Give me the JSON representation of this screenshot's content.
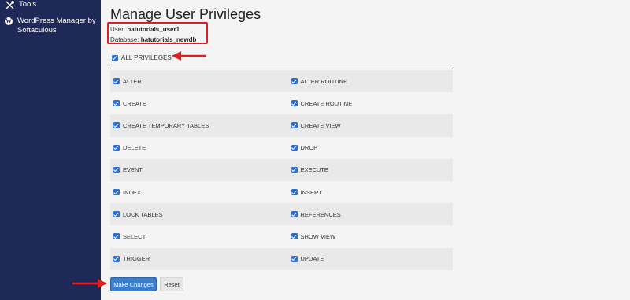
{
  "sidebar": {
    "items": [
      {
        "label": "Tools",
        "icon": "tools-icon"
      },
      {
        "label": "WordPress Manager by Softaculous",
        "icon": "wordpress-icon"
      }
    ]
  },
  "main": {
    "title": "Manage User Privileges",
    "user_label": "User:",
    "user_value": "hatutorials_user1",
    "database_label": "Database:",
    "database_value": "hatutorials_newdb",
    "all_privileges_label": "ALL PRIVILEGES",
    "privileges": [
      [
        "ALTER",
        "ALTER ROUTINE"
      ],
      [
        "CREATE",
        "CREATE ROUTINE"
      ],
      [
        "CREATE TEMPORARY TABLES",
        "CREATE VIEW"
      ],
      [
        "DELETE",
        "DROP"
      ],
      [
        "EVENT",
        "EXECUTE"
      ],
      [
        "INDEX",
        "INSERT"
      ],
      [
        "LOCK TABLES",
        "REFERENCES"
      ],
      [
        "SELECT",
        "SHOW VIEW"
      ],
      [
        "TRIGGER",
        "UPDATE"
      ]
    ],
    "make_changes_label": "Make Changes",
    "reset_label": "Reset"
  },
  "colors": {
    "sidebar_bg": "#1f2957",
    "checkbox": "#2e6fd6",
    "primary_button": "#3b7dc8",
    "annotation": "#e02020"
  }
}
